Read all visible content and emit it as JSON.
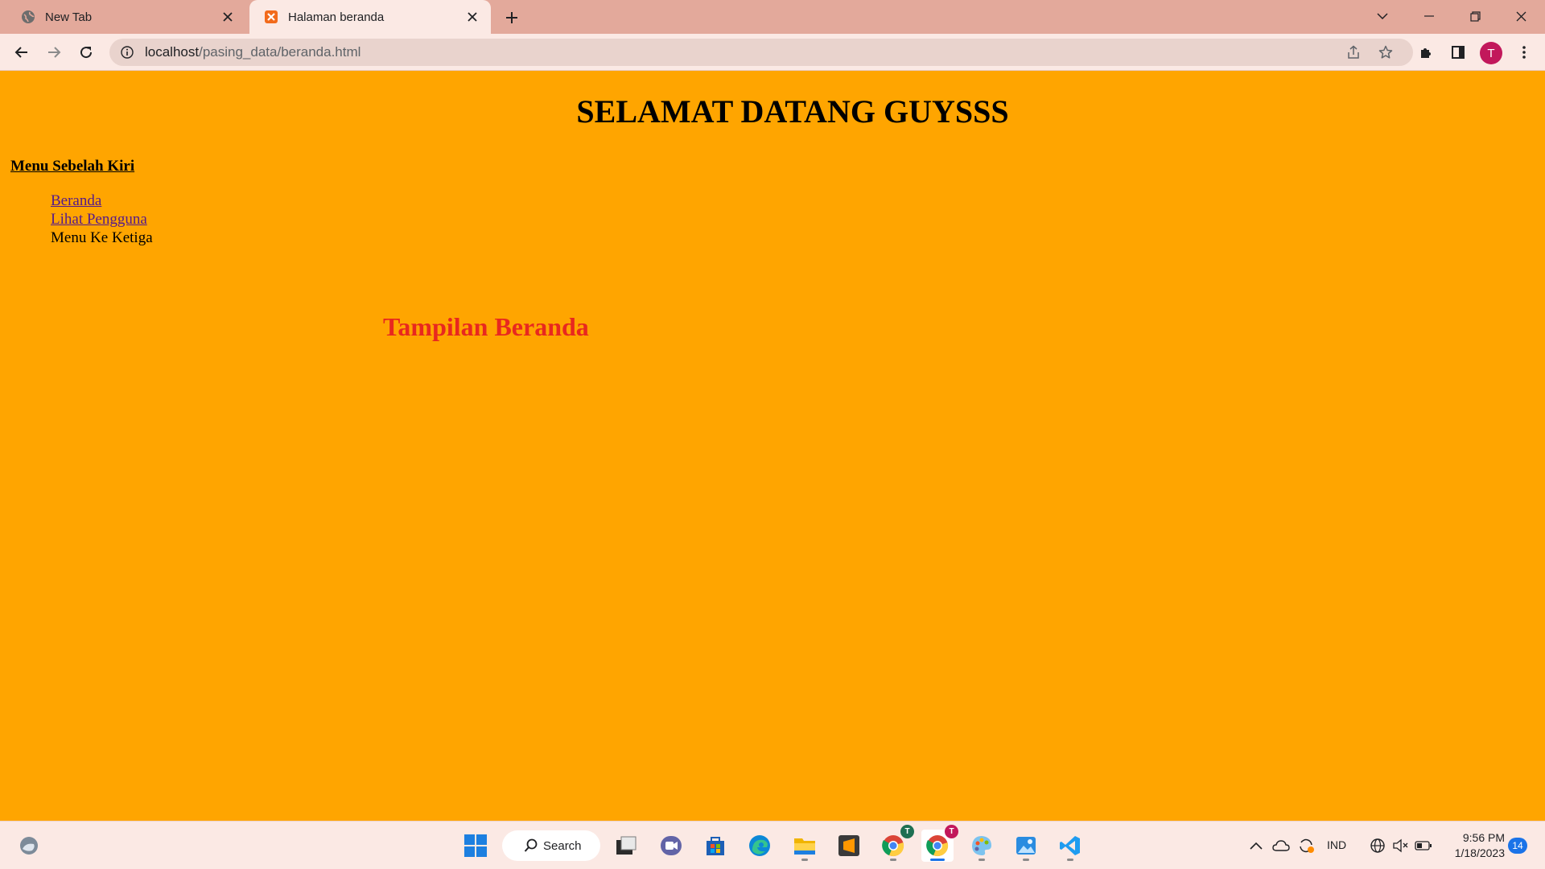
{
  "browser": {
    "tabs": [
      {
        "title": "New Tab",
        "icon": "globe-icon",
        "active": false
      },
      {
        "title": "Halaman beranda",
        "icon": "xampp-icon",
        "active": true
      }
    ],
    "url": {
      "host": "localhost",
      "path": "/pasing_data/beranda.html"
    },
    "profile_initial": "T"
  },
  "page": {
    "title": "SELAMAT DATANG GUYSSS",
    "menu_heading": "Menu Sebelah Kiri",
    "menu_items": [
      {
        "label": "Beranda",
        "link": true
      },
      {
        "label": "Lihat Pengguna",
        "link": true
      },
      {
        "label": "Menu Ke Ketiga",
        "link": false
      }
    ],
    "main_heading": "Tampilan Beranda"
  },
  "taskbar": {
    "search_label": "Search",
    "apps": [
      "windows-start-icon",
      "task-view-icon",
      "teams-chat-icon",
      "microsoft-store-icon",
      "edge-icon",
      "file-explorer-icon",
      "sublime-text-icon",
      "chrome-profile-icon",
      "chrome-active-icon",
      "paint-app-icon",
      "photos-app-icon",
      "vscode-icon"
    ],
    "chrome_badge_1": "T",
    "chrome_badge_2": "T",
    "language": "IND",
    "time": "9:56 PM",
    "date": "1/18/2023",
    "notifications": "14"
  },
  "colors": {
    "page_background": "#ffa500",
    "heading_red": "#e8281f",
    "link_visited": "#551a8b",
    "tabstrip": "#e3a99b",
    "toolbar": "#fbe9e4"
  }
}
